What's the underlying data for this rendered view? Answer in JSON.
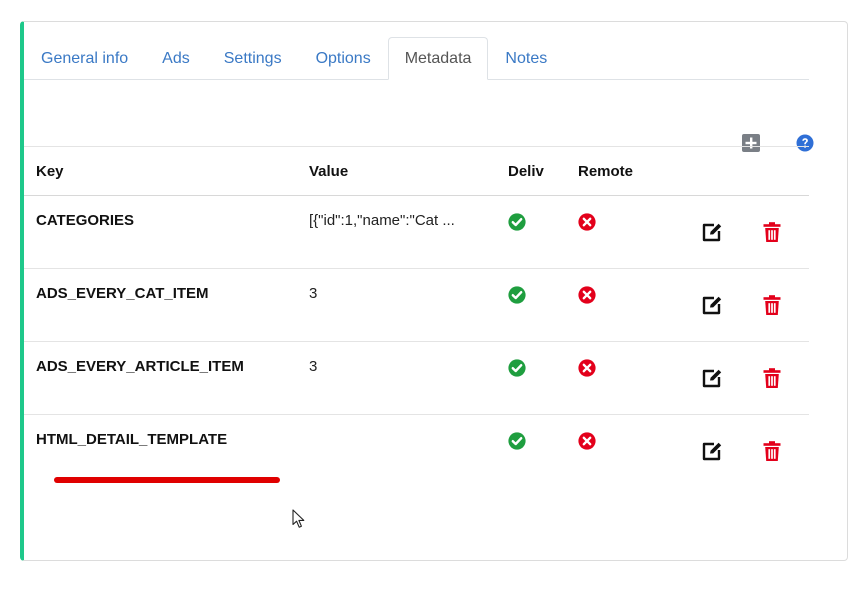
{
  "tabs": [
    {
      "label": "General info",
      "active": false
    },
    {
      "label": "Ads",
      "active": false
    },
    {
      "label": "Settings",
      "active": false
    },
    {
      "label": "Options",
      "active": false
    },
    {
      "label": "Metadata",
      "active": true
    },
    {
      "label": "Notes",
      "active": false
    }
  ],
  "toolbar": {
    "add_icon": "plus-square-icon",
    "help_icon": "question-circle-icon"
  },
  "table": {
    "headers": {
      "key": "Key",
      "value": "Value",
      "deliv": "Deliv",
      "remote": "Remote"
    },
    "rows": [
      {
        "key": "CATEGORIES",
        "value": "[{\"id\":1,\"name\":\"Cat ...",
        "deliv": true,
        "remote": false
      },
      {
        "key": "ADS_EVERY_CAT_ITEM",
        "value": "3",
        "deliv": true,
        "remote": false
      },
      {
        "key": "ADS_EVERY_ARTICLE_ITEM",
        "value": "3",
        "deliv": true,
        "remote": false
      },
      {
        "key": "HTML_DETAIL_TEMPLATE",
        "value": "",
        "deliv": true,
        "remote": false
      }
    ]
  },
  "colors": {
    "accent_border": "#1ec88a",
    "tab_link": "#3a79c5",
    "check_green": "#1f9e3f",
    "cross_red": "#e3001b",
    "trash_red": "#e3001b",
    "help_blue": "#2f6fd6",
    "add_gray": "#7a7f86",
    "annotation_red": "#e00000"
  }
}
